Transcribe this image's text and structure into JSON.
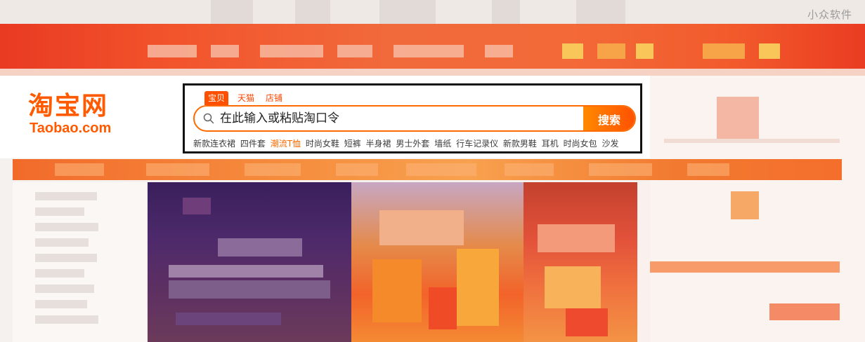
{
  "watermark": "小众软件",
  "logo": {
    "cn": "淘宝网",
    "en": "Taobao.com"
  },
  "search": {
    "tabs": [
      {
        "label": "宝贝",
        "active": true
      },
      {
        "label": "天猫",
        "active": false
      },
      {
        "label": "店铺",
        "active": false
      }
    ],
    "placeholder": "在此输入或粘贴淘口令",
    "value": "",
    "button_label": "搜索",
    "hot_words": [
      {
        "label": "新款连衣裙",
        "highlight": false
      },
      {
        "label": "四件套",
        "highlight": false
      },
      {
        "label": "潮流T恤",
        "highlight": true
      },
      {
        "label": "时尚女鞋",
        "highlight": false
      },
      {
        "label": "短裤",
        "highlight": false
      },
      {
        "label": "半身裙",
        "highlight": false
      },
      {
        "label": "男士外套",
        "highlight": false
      },
      {
        "label": "墙纸",
        "highlight": false
      },
      {
        "label": "行车记录仪",
        "highlight": false
      },
      {
        "label": "新款男鞋",
        "highlight": false
      },
      {
        "label": "耳机",
        "highlight": false
      },
      {
        "label": "时尚女包",
        "highlight": false
      },
      {
        "label": "沙发",
        "highlight": false
      }
    ]
  },
  "colors": {
    "brand": "#ff5000",
    "highlight_border": "#111111",
    "hot_highlight": "#ff6a00"
  },
  "icons": {
    "search": "search-icon"
  }
}
